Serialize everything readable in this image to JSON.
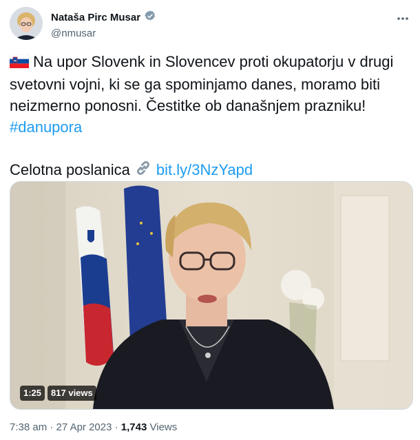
{
  "author": {
    "display_name": "Nataša Pirc Musar",
    "handle": "@nmusar"
  },
  "tweet": {
    "flag_icon": "slovenia-flag-icon",
    "text": "Na upor Slovenk in Slovencev proti okupatorju v drugi svetovni vojni, ki se ga spominjamo danes, moramo biti neizmerno ponosni. Čestitke ob današnjem prazniku!",
    "hashtag": "#danupora",
    "link_prefix": "Celotna poslanica",
    "link_icon": "link-icon",
    "link_text": "bit.ly/3NzYapd"
  },
  "video": {
    "duration": "1:25",
    "views": "817 views"
  },
  "meta": {
    "time": "7:38 am",
    "separator": "·",
    "date": "27 Apr 2023",
    "view_count": "1,743",
    "views_label": "Views"
  },
  "colors": {
    "accent": "#1d9bf0",
    "text": "#0f1419",
    "muted": "#536471"
  }
}
